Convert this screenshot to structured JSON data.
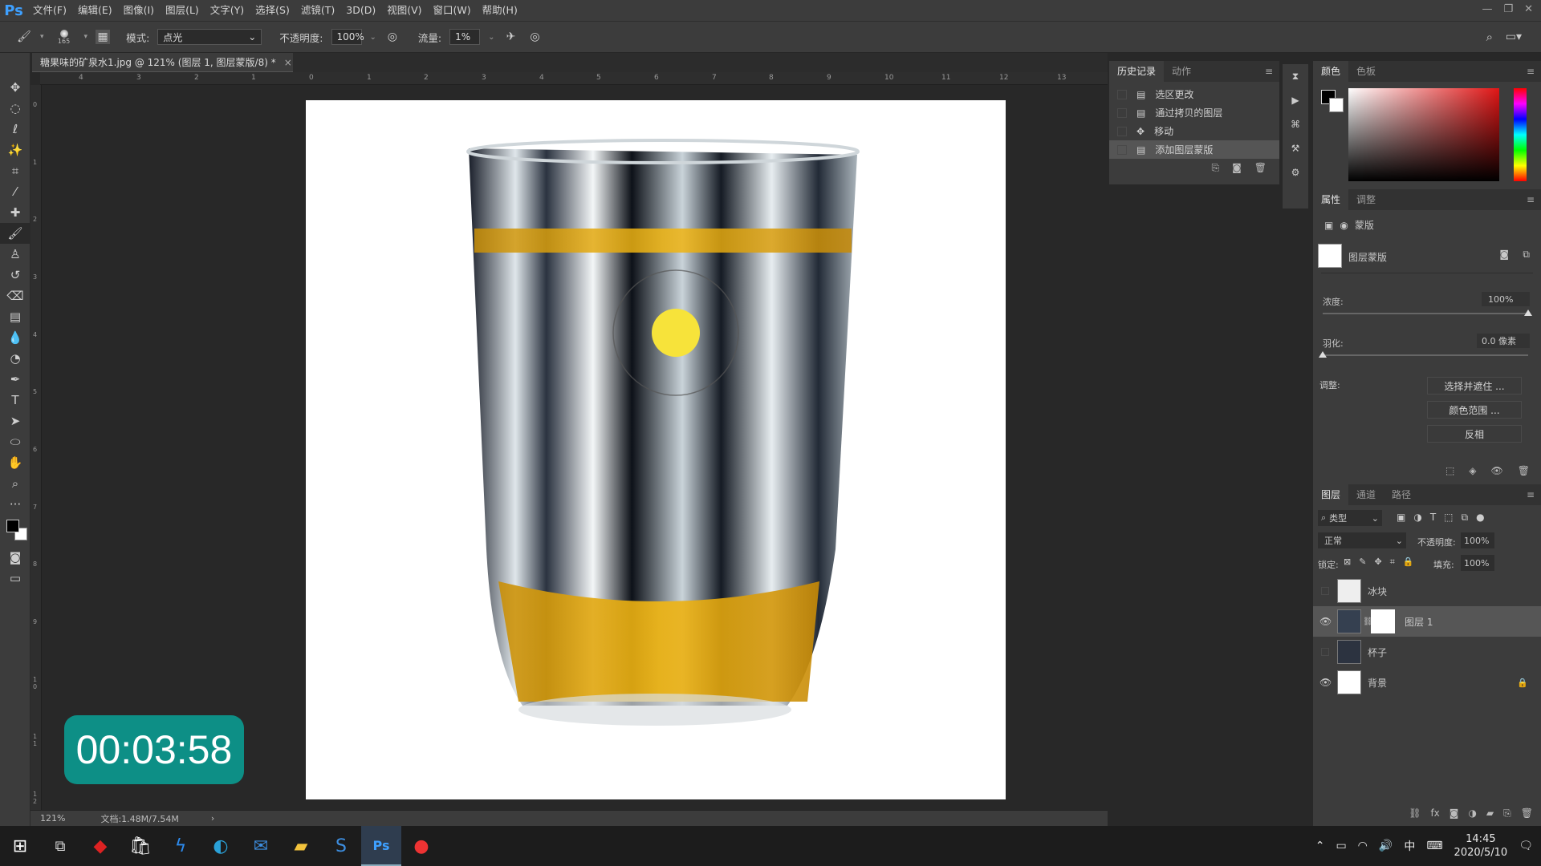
{
  "app": {
    "logo": "Ps",
    "menu": [
      "文件(F)",
      "编辑(E)",
      "图像(I)",
      "图层(L)",
      "文字(Y)",
      "选择(S)",
      "滤镜(T)",
      "3D(D)",
      "视图(V)",
      "窗口(W)",
      "帮助(H)"
    ]
  },
  "options": {
    "brush_size": "165",
    "mode_label": "模式:",
    "mode_value": "点光",
    "opacity_label": "不透明度:",
    "opacity_value": "100%",
    "flow_label": "流量:",
    "flow_value": "1%"
  },
  "document": {
    "tab_title": "糖果味的矿泉水1.jpg @ 121% (图层 1, 图层蒙版/8) *",
    "tab_close": "×",
    "zoom": "121%",
    "doc_size": "文档:1.48M/7.54M",
    "status_arrow": "›"
  },
  "ruler": {
    "h_ticks": [
      "4",
      "3",
      "2",
      "1",
      "0",
      "1",
      "2",
      "3",
      "4",
      "5",
      "6",
      "7",
      "8",
      "9",
      "10",
      "11",
      "12",
      "13"
    ],
    "v_ticks": [
      "0",
      "1",
      "2",
      "3",
      "4",
      "5",
      "6",
      "7",
      "8",
      "9",
      "1 0",
      "1 1",
      "1 2"
    ]
  },
  "history": {
    "tabs": [
      "历史记录",
      "动作"
    ],
    "items": [
      {
        "label": "选区更改",
        "active": false
      },
      {
        "label": "通过拷贝的图层",
        "active": false
      },
      {
        "label": "移动",
        "active": false
      },
      {
        "label": "添加图层蒙版",
        "active": true
      }
    ]
  },
  "color_panel": {
    "tabs": [
      "颜色",
      "色板"
    ]
  },
  "properties": {
    "tabs": [
      "属性",
      "调整"
    ],
    "type_label": "蒙版",
    "mask_label": "图层蒙版",
    "density_label": "浓度:",
    "density_value": "100%",
    "density_level": 1.0,
    "feather_label": "羽化:",
    "feather_value": "0.0 像素",
    "feather_level": 0.0,
    "adjust_label": "调整:",
    "buttons": [
      "选择并遮住 ...",
      "颜色范围 ...",
      "反相"
    ]
  },
  "layers": {
    "tabs": [
      "图层",
      "通道",
      "路径"
    ],
    "filter_label": "类型",
    "blend_mode": "正常",
    "opacity_label": "不透明度:",
    "opacity_value": "100%",
    "lock_label": "锁定:",
    "fill_label": "填充:",
    "fill_value": "100%",
    "items": [
      {
        "name": "冰块",
        "visible": false,
        "selected": false
      },
      {
        "name": "图层 1",
        "visible": true,
        "selected": true
      },
      {
        "name": "杯子",
        "visible": false,
        "selected": false
      },
      {
        "name": "背景",
        "visible": true,
        "selected": false
      }
    ]
  },
  "timer": "00:03:58",
  "taskbar": {
    "time": "14:45",
    "date": "2020/5/10",
    "ime": "中"
  },
  "colors": {
    "accent": "#0d8f86",
    "ps_blue": "#3ea0ff",
    "cursor_dot": "#f7e33a",
    "liquid": "#e8a90c"
  }
}
